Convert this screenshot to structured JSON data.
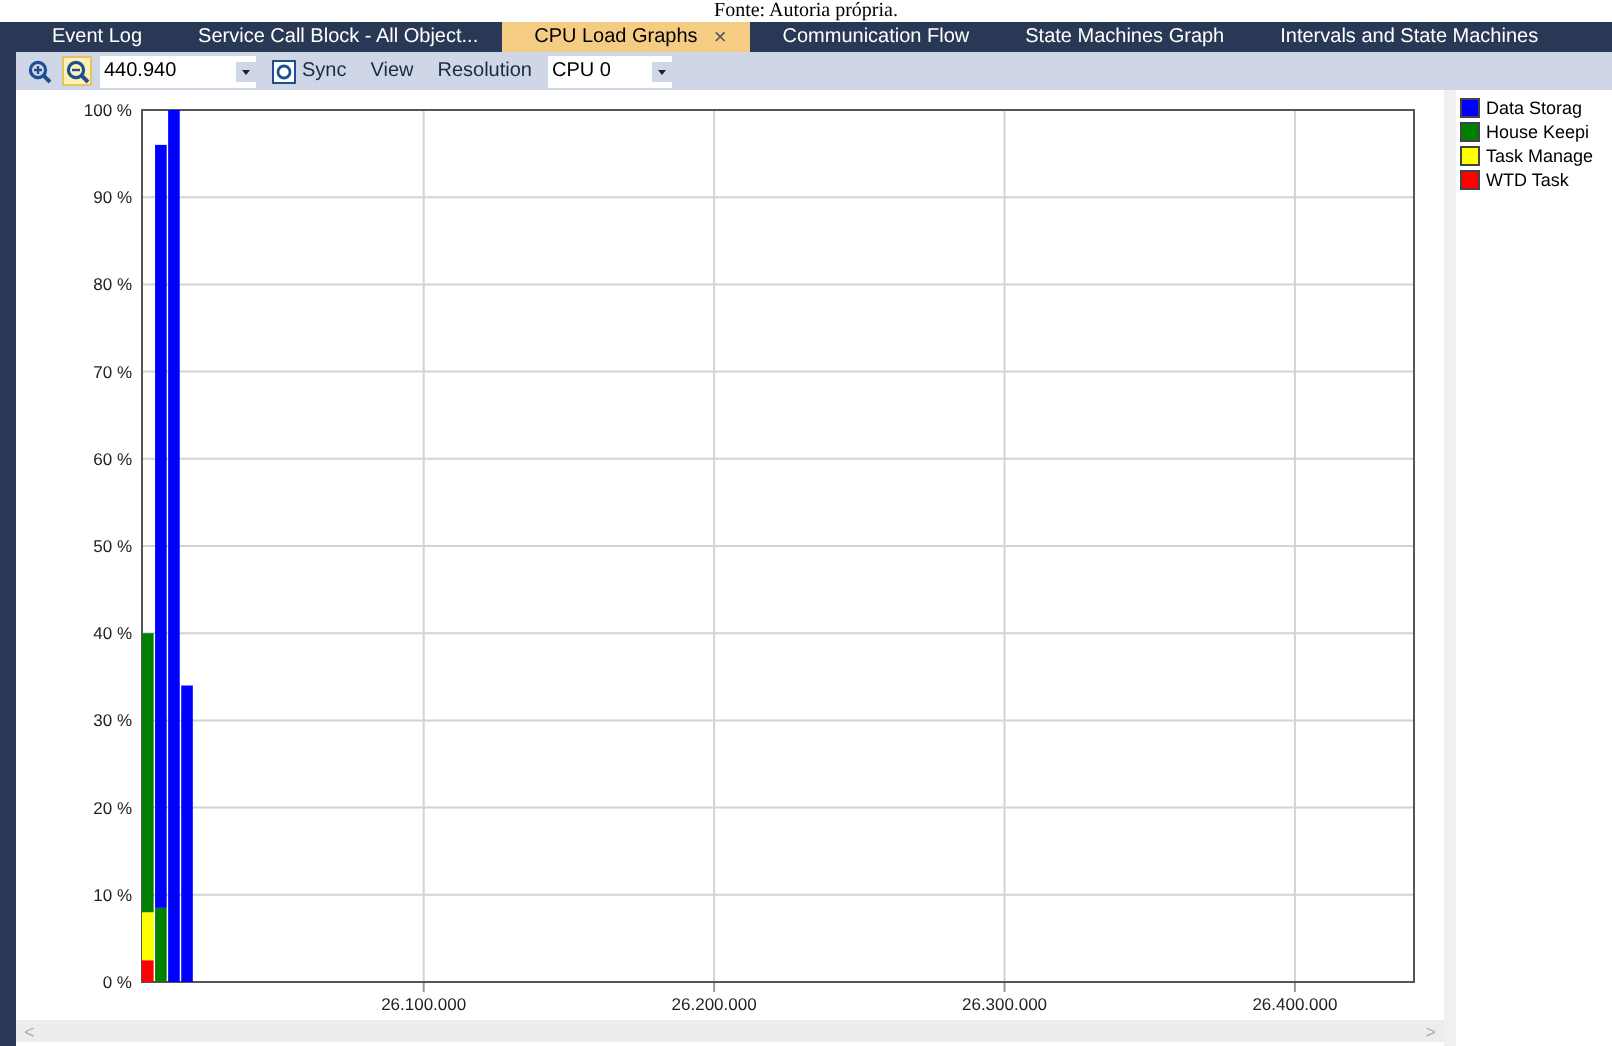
{
  "caption": "Fonte: Autoria própria.",
  "tabs": [
    {
      "label": "Event Log",
      "selected": false
    },
    {
      "label": "Service Call Block - All Object...",
      "selected": false
    },
    {
      "label": "CPU Load Graphs",
      "selected": true,
      "close": "×"
    },
    {
      "label": "Communication Flow",
      "selected": false
    },
    {
      "label": "State Machines Graph",
      "selected": false
    },
    {
      "label": "Intervals and State Machines",
      "selected": false
    }
  ],
  "toolbar": {
    "zoom_buttons": [
      {
        "kind": "zoom-in",
        "selected": false
      },
      {
        "kind": "zoom-out",
        "selected": true
      }
    ],
    "zoom_value": "440.940",
    "sync": "Sync",
    "view": "View",
    "resolution": "Resolution",
    "cpu": "CPU 0"
  },
  "scrollbar": {
    "left": "<",
    "right": ">"
  },
  "chart_data": {
    "type": "bar",
    "stacked": true,
    "grid": true,
    "xlim": [
      26003000,
      26441000
    ],
    "ylim": [
      0,
      100
    ],
    "x": [
      26005000,
      26009500,
      26014000,
      26018500
    ],
    "series": [
      {
        "name": "Data Storag",
        "color": "#0000ff",
        "values": [
          0,
          87.5,
          100,
          34
        ]
      },
      {
        "name": "House Keepi",
        "color": "#008000",
        "values": [
          32,
          8.5,
          0,
          0
        ]
      },
      {
        "name": "Task Manage",
        "color": "#ffff00",
        "values": [
          5.5,
          0,
          0,
          0
        ]
      },
      {
        "name": "WTD Task",
        "color": "#ff0000",
        "values": [
          2.5,
          0,
          0,
          0
        ]
      }
    ],
    "xticks": [
      {
        "value": 26100000,
        "label": "26.100.000"
      },
      {
        "value": 26200000,
        "label": "26.200.000"
      },
      {
        "value": 26300000,
        "label": "26.300.000"
      },
      {
        "value": 26400000,
        "label": "26.400.000"
      }
    ],
    "yticks": [
      {
        "value": 0,
        "label": "0 %"
      },
      {
        "value": 10,
        "label": "10 %"
      },
      {
        "value": 20,
        "label": "20 %"
      },
      {
        "value": 30,
        "label": "30 %"
      },
      {
        "value": 40,
        "label": "40 %"
      },
      {
        "value": 50,
        "label": "50 %"
      },
      {
        "value": 60,
        "label": "60 %"
      },
      {
        "value": 70,
        "label": "70 %"
      },
      {
        "value": 80,
        "label": "80 %"
      },
      {
        "value": 90,
        "label": "90 %"
      },
      {
        "value": 100,
        "label": "100 %"
      }
    ]
  }
}
